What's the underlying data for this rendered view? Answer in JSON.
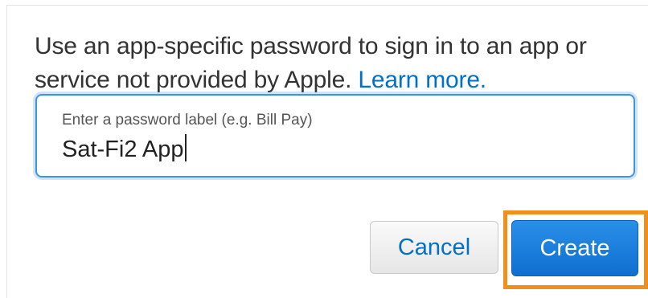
{
  "dialog": {
    "message": "Use an app-specific password to sign in to an app or service not provided by Apple.",
    "learn_more_link": "Learn more.",
    "password_label": {
      "placeholder": "Enter a password label (e.g. Bill Pay)",
      "value": "Sat-Fi2 App"
    },
    "buttons": {
      "cancel": "Cancel",
      "create": "Create"
    }
  },
  "colors": {
    "link": "#0070c9",
    "focus_ring": "#3d94e6",
    "primary_button": "#1a7fde",
    "highlight_box": "#f0901a"
  }
}
